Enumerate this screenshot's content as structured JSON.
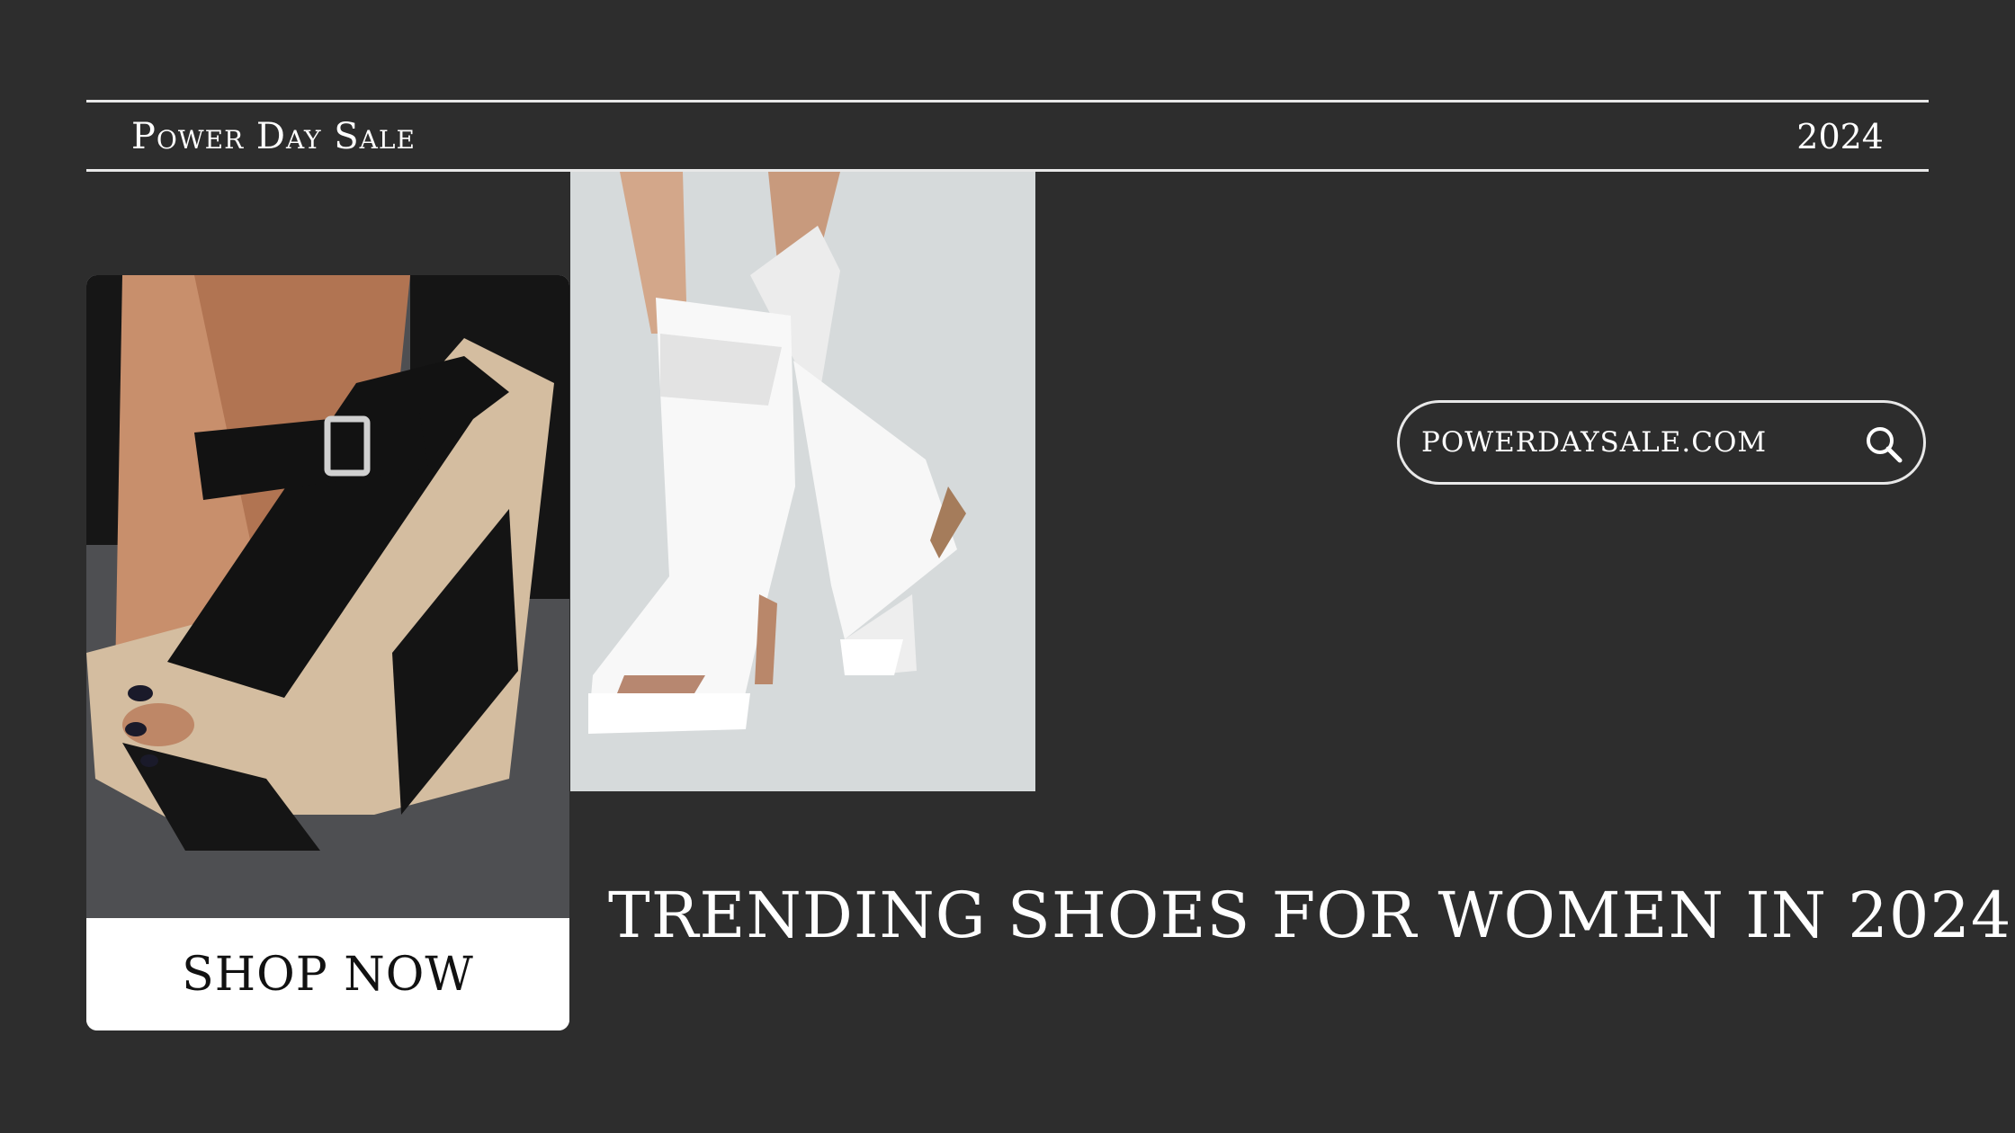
{
  "header": {
    "brand": "Power Day Sale",
    "year": "2024"
  },
  "card": {
    "image": "wedge-sandal-photo",
    "button_label": "SHOP NOW"
  },
  "feature_image": "white-peep-toe-boot-photo",
  "search": {
    "text": "POWERDAYSALE.COM",
    "icon": "search-icon"
  },
  "headline": "TRENDING SHOES FOR WOMEN IN 2024",
  "colors": {
    "background": "#2d2d2d",
    "text": "#ffffff",
    "rule": "#e8e8e8",
    "button_bg": "#ffffff",
    "button_text": "#111111"
  }
}
